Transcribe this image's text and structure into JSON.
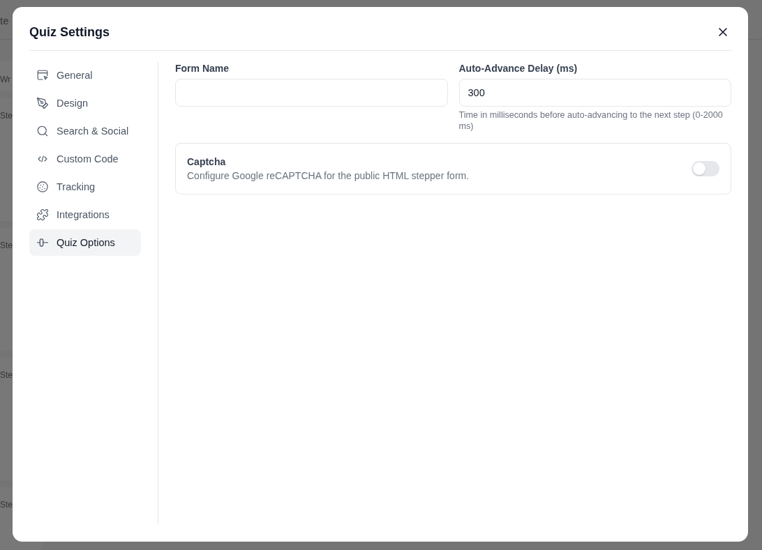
{
  "background_page": {
    "heading": "te",
    "rows": [
      "Wr",
      "Ste",
      "Ste",
      "Ste",
      "Ste"
    ]
  },
  "dialog": {
    "title": "Quiz Settings",
    "sidebar": {
      "items": [
        {
          "label": "General",
          "selected": false
        },
        {
          "label": "Design",
          "selected": false
        },
        {
          "label": "Search & Social",
          "selected": false
        },
        {
          "label": "Custom Code",
          "selected": false
        },
        {
          "label": "Tracking",
          "selected": false
        },
        {
          "label": "Integrations",
          "selected": false
        },
        {
          "label": "Quiz Options",
          "selected": true
        }
      ]
    },
    "fields": [
      {
        "label": "Form Name"
      },
      {
        "label": "Auto-Advance Delay (ms)",
        "value": "300",
        "help": "Time in milliseconds before auto-advancing to the next step (0-2000 ms)"
      }
    ],
    "captcha": {
      "title": "Captcha",
      "description": "Configure Google reCAPTCHA for the public HTML stepper form.",
      "on": false
    }
  }
}
